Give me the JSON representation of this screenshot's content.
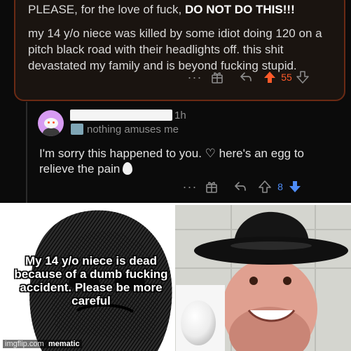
{
  "comment_top": {
    "line1_prefix": "PLEASE, for the love of fuck,",
    "line1_emphasis": "DO NOT DO THIS!!!",
    "body": "my 14 y/o niece was killed by some idiot doing 120 on a pitch black road with their headlights off. this shit devastated my family and is beyond fucking stupid.",
    "actions": {
      "more": "···",
      "score": "55"
    }
  },
  "reply": {
    "timestamp": "1h",
    "flair": "nothing amuses me",
    "body": "I'm sorry this happened to you. ♡ here's an egg to relieve the pain",
    "actions": {
      "more": "···",
      "score": "8"
    }
  },
  "meme": {
    "caption": "My 14 y/o niece is dead because of a dumb fucking accident. Please be more careful",
    "watermark_site": "imgflip.com",
    "watermark_app": "mematic"
  },
  "colors": {
    "upvote_active": "#ff5a2a",
    "downvote_active": "#4e8cf5",
    "comment_border": "#6b2a14",
    "avatar_bg": "#d79bf2"
  },
  "icons": {
    "award": "award-icon",
    "reply": "reply-icon",
    "upvote": "upvote-arrow-icon",
    "downvote": "downvote-arrow-icon"
  }
}
